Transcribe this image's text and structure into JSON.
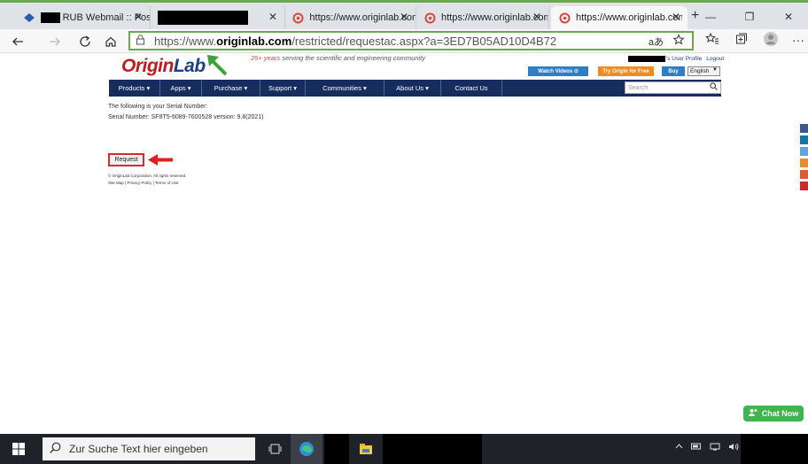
{
  "browser": {
    "tabs": [
      {
        "label": "RUB Webmail :: Poste",
        "close": "✕"
      },
      {
        "label": "",
        "close": "✕"
      },
      {
        "label": "https://www.originlab.com",
        "close": "✕"
      },
      {
        "label": "https://www.originlab.com",
        "close": "✕"
      },
      {
        "label": "https://www.originlab.com",
        "close": "✕"
      }
    ],
    "new_tab": "+",
    "window": {
      "minimize": "—",
      "restore": "❐",
      "close": "✕"
    },
    "url": {
      "prefix": "https://www.",
      "domain": "originlab.com",
      "path": "/restricted/requestac.aspx?a=3ED7B05AD10D4B72"
    },
    "read_aloud": "aあ",
    "more": "···"
  },
  "site": {
    "logo_origin": "Origin",
    "logo_lab": "Lab",
    "tagline_highlight": "25+ years",
    "tagline_rest": " serving the scientific and engineering community",
    "user_profile": "'s User Profile",
    "logout": "Logout",
    "watch_videos": "Watch Videos ⊙",
    "try_origin": "Try Origin for Free",
    "buy": "Buy",
    "language": "English",
    "menu": [
      "Products ▾",
      "Apps ▾",
      "Purchase ▾",
      "Support ▾",
      "Communities ▾",
      "About Us ▾",
      "Contact Us"
    ],
    "search_placeholder": "Search",
    "serial_intro": "The following is your Serial Number:",
    "serial_line": "Serial Number: SF8T5-6089-7600528 version: 9.8(2021)",
    "request": "Request",
    "copyright": "© OriginLab Corporation. All rights reserved.",
    "footer_links": "Site Map | Privacy Policy | Terms of Use",
    "chat_now": "Chat Now"
  },
  "taskbar": {
    "search_placeholder": "Zur Suche Text hier eingeben"
  },
  "colors": {
    "accent_green": "#6aa84f",
    "origin_red": "#c01a1a",
    "origin_blue": "#1d3f86",
    "menu_navy": "#172e5c",
    "annotation_red": "#d42b2b",
    "chat_green": "#3eb551"
  }
}
